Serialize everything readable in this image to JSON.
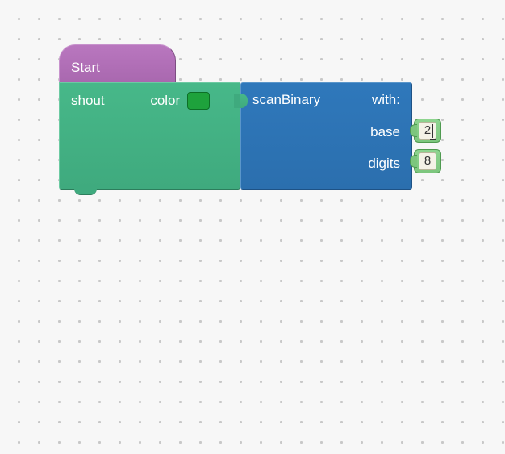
{
  "hat": {
    "label": "Start"
  },
  "shout_block": {
    "label": "shout",
    "color_label": "color",
    "color_value": "#1ea23c"
  },
  "scan_block": {
    "name": "scanBinary",
    "with": "with:",
    "params": {
      "base": {
        "label": "base",
        "value": "2"
      },
      "digits": {
        "label": "digits",
        "value": "8"
      }
    }
  }
}
